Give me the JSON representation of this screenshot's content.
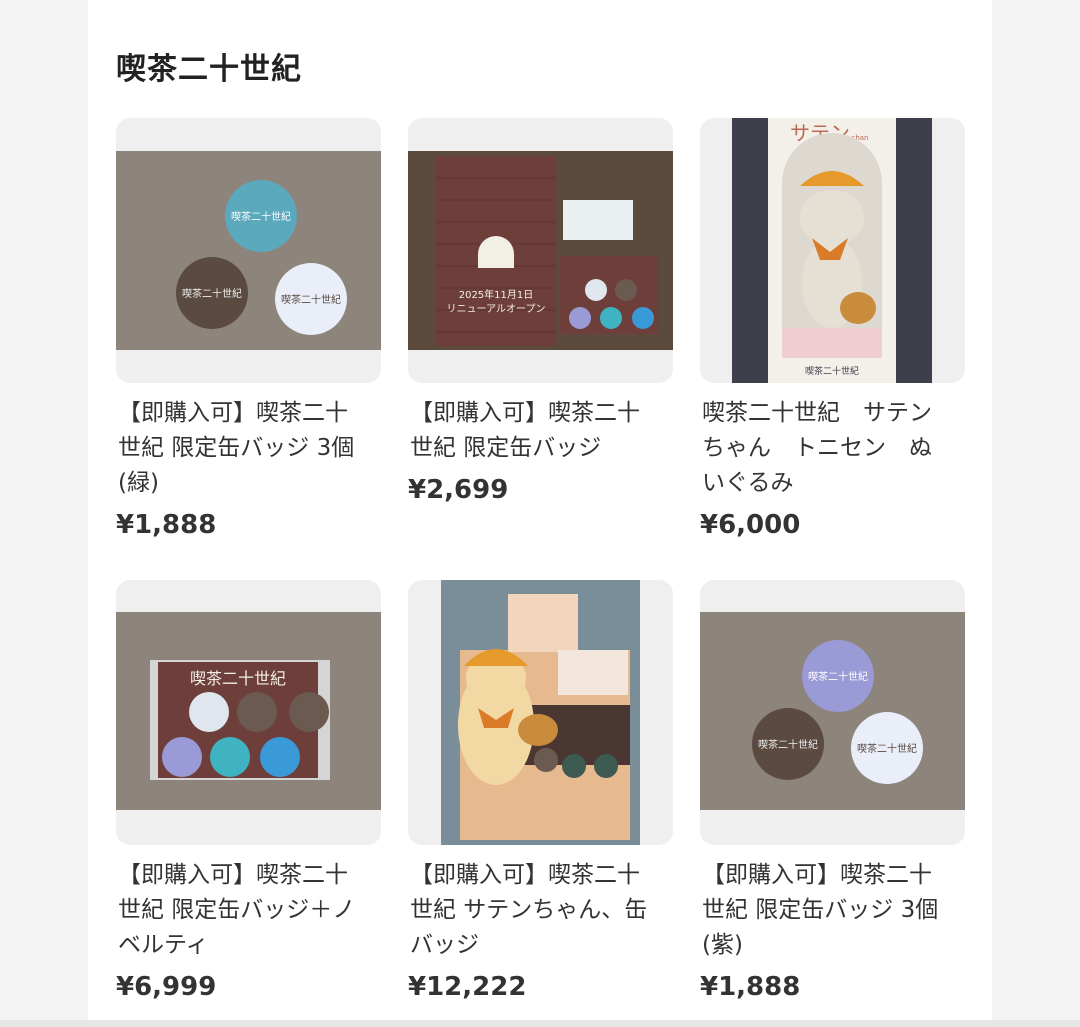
{
  "section": {
    "title": "喫茶二十世紀"
  },
  "items": [
    {
      "title": "【即購入可】喫茶二十\n世紀 限定缶バッジ 3個\n(緑)",
      "price": "¥1,888",
      "image_icon": "badge-set-green-thumbnail-icon"
    },
    {
      "title": "【即購入可】喫茶二十\n世紀 限定缶バッジ",
      "price": "¥2,699",
      "image_icon": "badge-and-folder-thumbnail-icon"
    },
    {
      "title": "喫茶二十世紀　サテン\nちゃん　トニセン　ぬ\nいぐるみ",
      "price": "¥6,000",
      "image_icon": "plush-doll-box-thumbnail-icon"
    },
    {
      "title": "【即購入可】喫茶二十\n世紀 限定缶バッジ＋ノ\nベルティ",
      "price": "¥6,999",
      "image_icon": "badge-pack-thumbnail-icon"
    },
    {
      "title": "【即購入可】喫茶二十\n世紀 サテンちゃん、缶\nバッジ",
      "price": "¥12,222",
      "image_icon": "plush-and-badges-thumbnail-icon"
    },
    {
      "title": "【即購入可】喫茶二十\n世紀 限定缶バッジ 3個\n(紫)",
      "price": "¥1,888",
      "image_icon": "badge-set-purple-thumbnail-icon"
    }
  ],
  "image_text": {
    "badge_label": "喫茶二十世紀",
    "folder_date": "2025年11月1日",
    "folder_open": "リニューアルオープン",
    "plush_box_brand": "サテン",
    "plush_box_sub": "chan"
  },
  "colors": {
    "accent_green": "#5aa9bd",
    "accent_purple": "#9a9ad6",
    "badge_brown": "#5b4a40",
    "badge_white": "#e9eef8"
  }
}
